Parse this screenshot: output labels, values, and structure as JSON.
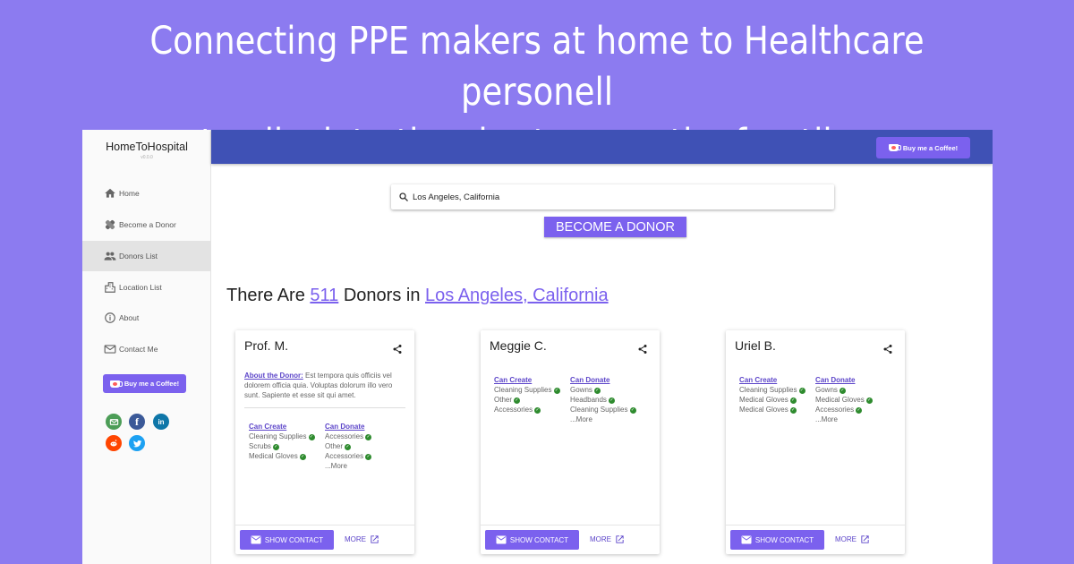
{
  "headline": {
    "line1": "Connecting PPE makers at home to Healthcare personell",
    "line2": "to alleviate the shortage on the frontline"
  },
  "app": {
    "title": "HomeToHospital",
    "version": "v0.0.0"
  },
  "sidebar": {
    "items": [
      {
        "label": "Home",
        "icon": "home-icon"
      },
      {
        "label": "Become a Donor",
        "icon": "healing-icon"
      },
      {
        "label": "Donors List",
        "icon": "people-icon",
        "active": true
      },
      {
        "label": "Location List",
        "icon": "city-icon"
      },
      {
        "label": "About",
        "icon": "info-icon"
      },
      {
        "label": "Contact Me",
        "icon": "mail-icon"
      }
    ],
    "coffee_label": "Buy me a Coffee!",
    "social": [
      "email-icon",
      "facebook-icon",
      "linkedin-icon",
      "reddit-icon",
      "twitter-icon"
    ]
  },
  "topbar": {
    "coffee_label": "Buy me a Coffee!"
  },
  "search": {
    "value": "Los Angeles, California"
  },
  "become_donor_label": "BECOME A DONOR",
  "heading": {
    "prefix": "There Are",
    "count": "511",
    "middle": "Donors in",
    "location": "Los Angeles, California"
  },
  "cards": [
    {
      "name": "Prof. M.",
      "about_label": "About the Donor:",
      "about_text": "Est tempora quis officiis vel dolorem officia quia. Voluptas dolorum illo vero sunt. Sapiente et esse sit qui amet.",
      "can_create_label": "Can Create",
      "can_create": [
        "Cleaning Supplies",
        "Scrubs",
        "Medical Gloves"
      ],
      "can_donate_label": "Can Donate",
      "can_donate": [
        "Accessories",
        "Other",
        "Accessories"
      ],
      "more_items": "...More",
      "show_contact": "SHOW CONTACT",
      "more": "MORE"
    },
    {
      "name": "Meggie C.",
      "can_create_label": "Can Create",
      "can_create": [
        "Cleaning Supplies",
        "Other",
        "Accessories"
      ],
      "can_donate_label": "Can Donate",
      "can_donate": [
        "Gowns",
        "Headbands",
        "Cleaning Supplies"
      ],
      "more_items": "...More",
      "show_contact": "SHOW CONTACT",
      "more": "MORE"
    },
    {
      "name": "Uriel B.",
      "can_create_label": "Can Create",
      "can_create": [
        "Cleaning Supplies",
        "Medical Gloves",
        "Medical Gloves"
      ],
      "can_donate_label": "Can Donate",
      "can_donate": [
        "Gowns",
        "Medical Gloves",
        "Accessories"
      ],
      "more_items": "...More",
      "show_contact": "SHOW CONTACT",
      "more": "MORE"
    }
  ],
  "colors": {
    "background": "#8c7bf0",
    "appbar": "#3f51b5",
    "accent": "#7b61ee",
    "check": "#2e8b2e"
  }
}
